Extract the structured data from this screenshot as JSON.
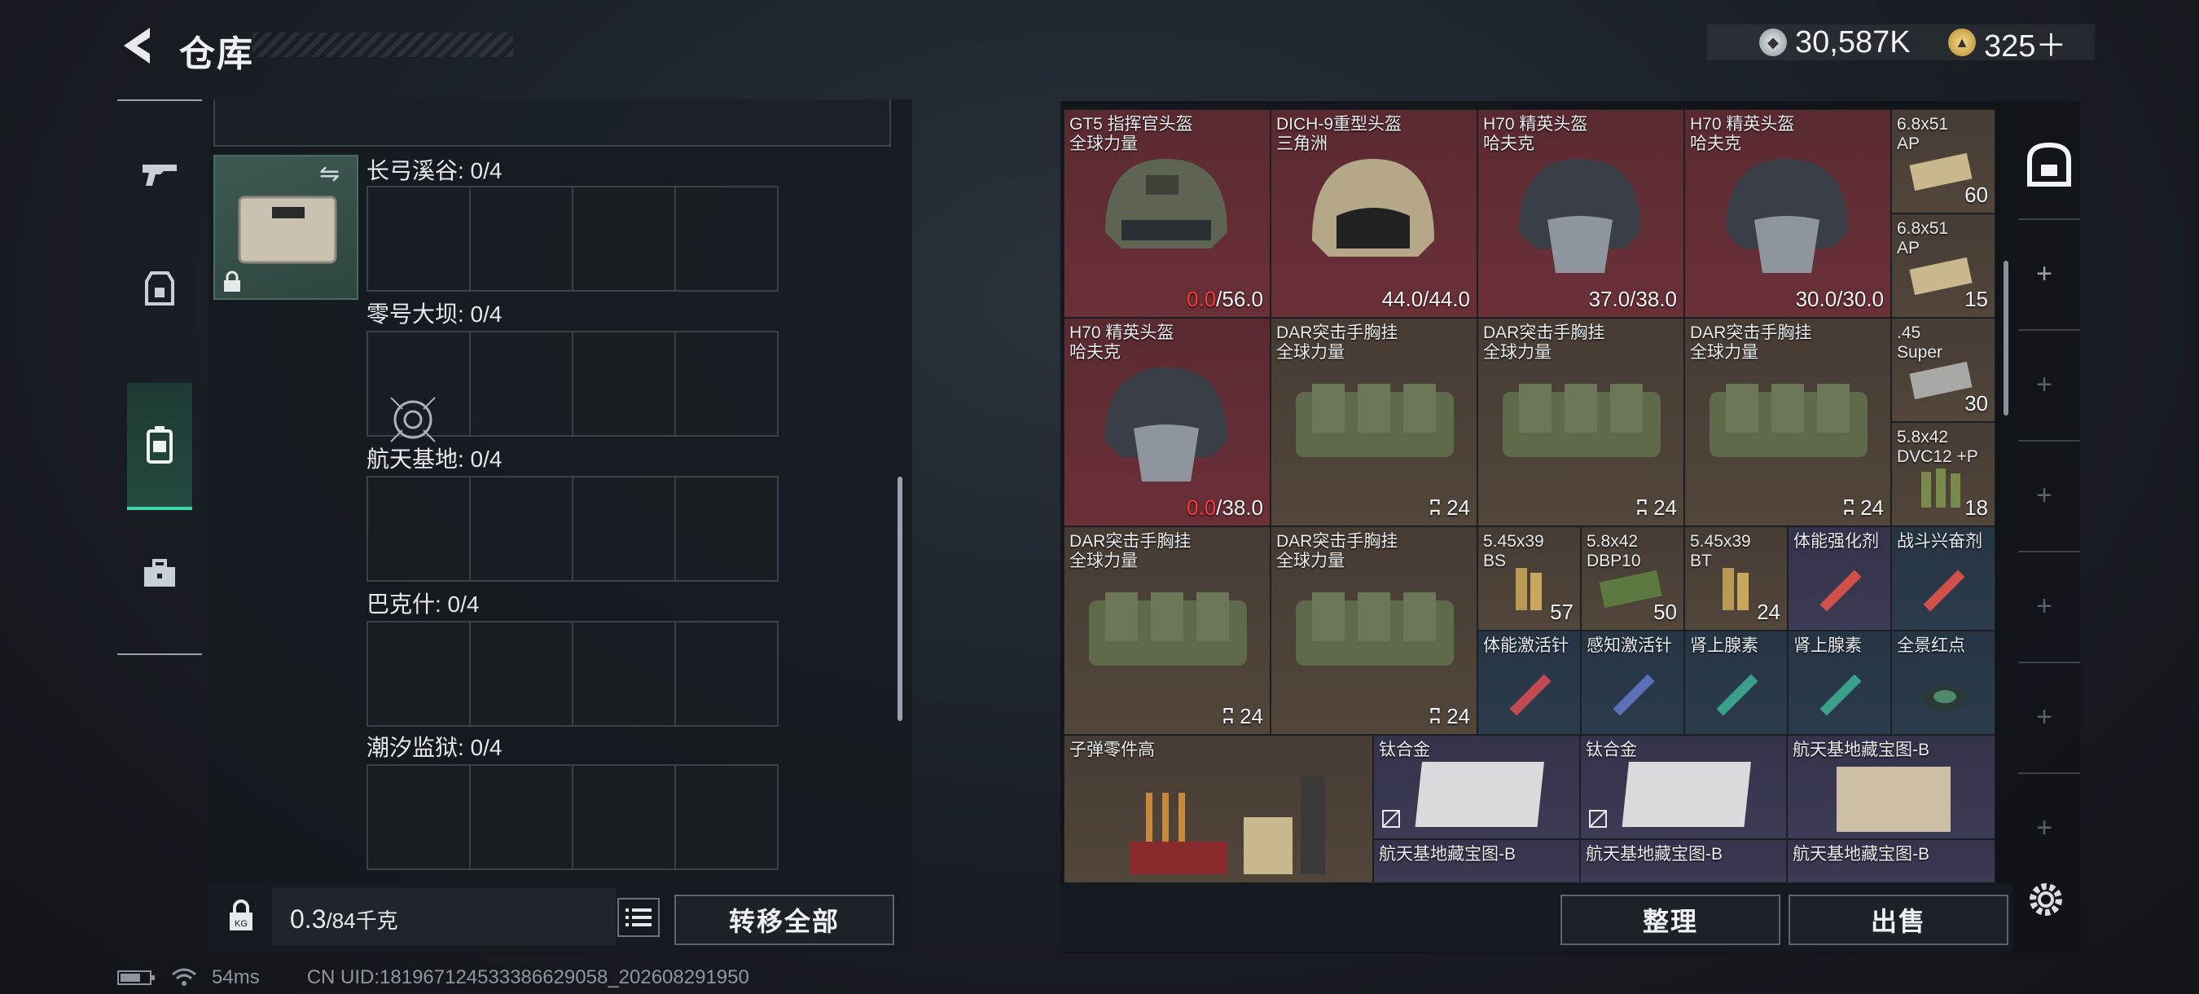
{
  "header": {
    "title": "仓库",
    "currency_silver": "30,587K",
    "currency_gold": "325＋"
  },
  "left_panel": {
    "maps": [
      {
        "label": "长弓溪谷: 0/4"
      },
      {
        "label": "零号大坝: 0/4"
      },
      {
        "label": "航天基地: 0/4"
      },
      {
        "label": "巴克什: 0/4"
      },
      {
        "label": "潮汐监狱: 0/4"
      }
    ],
    "weight_value": "0.3",
    "weight_total": "/84千克",
    "transfer_all_label": "转移全部"
  },
  "status_bar": {
    "ping": "54ms",
    "uid": "CN UID:1819671245333866290​58_202608291950"
  },
  "right_panel": {
    "items": [
      {
        "name1": "GT5 指挥官头盔",
        "name2": "全球力量",
        "dur_cur": "0.0",
        "dur_max": "/56.0",
        "cur_red": true
      },
      {
        "name1": "DICH-9重型头盔",
        "name2": "三角洲",
        "dur_cur": "44.0",
        "dur_max": "/44.0",
        "cur_red": false
      },
      {
        "name1": "H70 精英头盔",
        "name2": "哈夫克",
        "dur_cur": "37.0",
        "dur_max": "/38.0",
        "cur_red": false
      },
      {
        "name1": "H70 精英头盔",
        "name2": "哈夫克",
        "dur_cur": "30.0",
        "dur_max": "/30.0",
        "cur_red": false
      },
      {
        "name1": "H70 精英头盔",
        "name2": "哈夫克",
        "dur_cur": "0.0",
        "dur_max": "/38.0",
        "cur_red": true
      },
      {
        "name1": "DAR突击手胸挂",
        "name2": "全球力量",
        "capacity": "24"
      },
      {
        "name1": "DAR突击手胸挂",
        "name2": "全球力量",
        "capacity": "24"
      },
      {
        "name1": "DAR突击手胸挂",
        "name2": "全球力量",
        "capacity": "24"
      },
      {
        "name1": "DAR突击手胸挂",
        "name2": "全球力量",
        "capacity": "24"
      },
      {
        "name1": "DAR突击手胸挂",
        "name2": "全球力量",
        "capacity": "24"
      }
    ],
    "ammo": [
      {
        "name1": "6.8x51",
        "name2": "AP",
        "count": "60"
      },
      {
        "name1": "6.8x51",
        "name2": "AP",
        "count": "15"
      },
      {
        "name1": ".45",
        "name2": "Super",
        "count": "30"
      },
      {
        "name1": "5.8x42",
        "name2": "DVC12 +P",
        "count": "18"
      },
      {
        "name1": "5.45x39",
        "name2": "BS",
        "count": "57"
      },
      {
        "name1": "5.8x42",
        "name2": "DBP10",
        "count": "50"
      },
      {
        "name1": "5.45x39",
        "name2": "BT",
        "count": "24"
      }
    ],
    "consumables": [
      {
        "name": "体能强化剂"
      },
      {
        "name": "战斗兴奋剂"
      },
      {
        "name": "体能激活针"
      },
      {
        "name": "感知激活针"
      },
      {
        "name": "肾上腺素"
      },
      {
        "name": "肾上腺素"
      },
      {
        "name": "全景红点"
      }
    ],
    "misc": [
      {
        "name": "子弹零件高"
      },
      {
        "name": "钛合金"
      },
      {
        "name": "钛合金"
      },
      {
        "name": "航天基地藏宝图-B"
      },
      {
        "name": "航天基地藏宝图-B"
      },
      {
        "name": "航天基地藏宝图-B"
      },
      {
        "name": "航天基地藏宝图-B"
      }
    ],
    "organize_label": "整理",
    "sell_label": "出售"
  },
  "colors": {
    "accent": "#3fd6a4",
    "red_tier": "#6b3038",
    "gold_tier": "#52463b",
    "blue_tier": "#2d3c4d",
    "purple_tier": "#3c3b55",
    "durability_red": "#ff3a3a"
  },
  "icons": [
    "back-arrow-icon",
    "silver-coin-icon",
    "gold-coin-icon",
    "gun-icon",
    "armor-icon",
    "backpack-icon",
    "toolbox-icon",
    "swap-icon",
    "lock-icon",
    "weight-lock-icon",
    "list-icon",
    "vault-icon",
    "plus-icon",
    "gear-icon",
    "battery-icon",
    "wifi-icon"
  ]
}
